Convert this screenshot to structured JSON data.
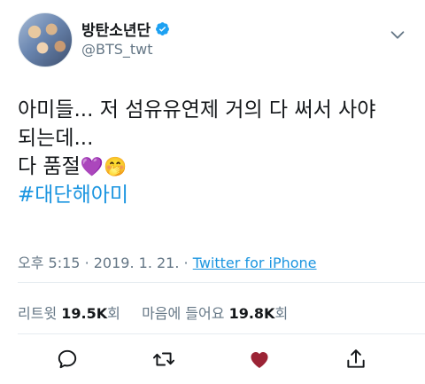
{
  "account": {
    "display_name": "방탄소년단",
    "handle": "@BTS_twt",
    "verified": true,
    "avatar_icon": "group-photo-avatar"
  },
  "tweet": {
    "line1": "아미들... 저 섬유유연제 거의 다 써서 사야",
    "line2": "되는데...",
    "line3_text": "다 품절",
    "line3_emoji1": "💜",
    "line3_emoji2": "🤭",
    "hashtag": "#대단해아미"
  },
  "meta": {
    "time": "오후 5:15",
    "separator": "·",
    "date": "2019. 1. 21.",
    "source": "Twitter for iPhone"
  },
  "stats": {
    "retweets_label": "리트윗",
    "retweets_count": "19.5K",
    "retweets_suffix": "회",
    "likes_label": "마음에 들어요",
    "likes_count": "19.8K",
    "likes_suffix": "회"
  },
  "colors": {
    "link": "#1b95e0",
    "muted": "#657786",
    "liked": "#9b2335",
    "verified": "#1da1f2"
  },
  "icons": {
    "menu": "chevron-down-icon",
    "reply": "reply-icon",
    "retweet": "retweet-icon",
    "like": "heart-icon",
    "share": "share-icon"
  }
}
